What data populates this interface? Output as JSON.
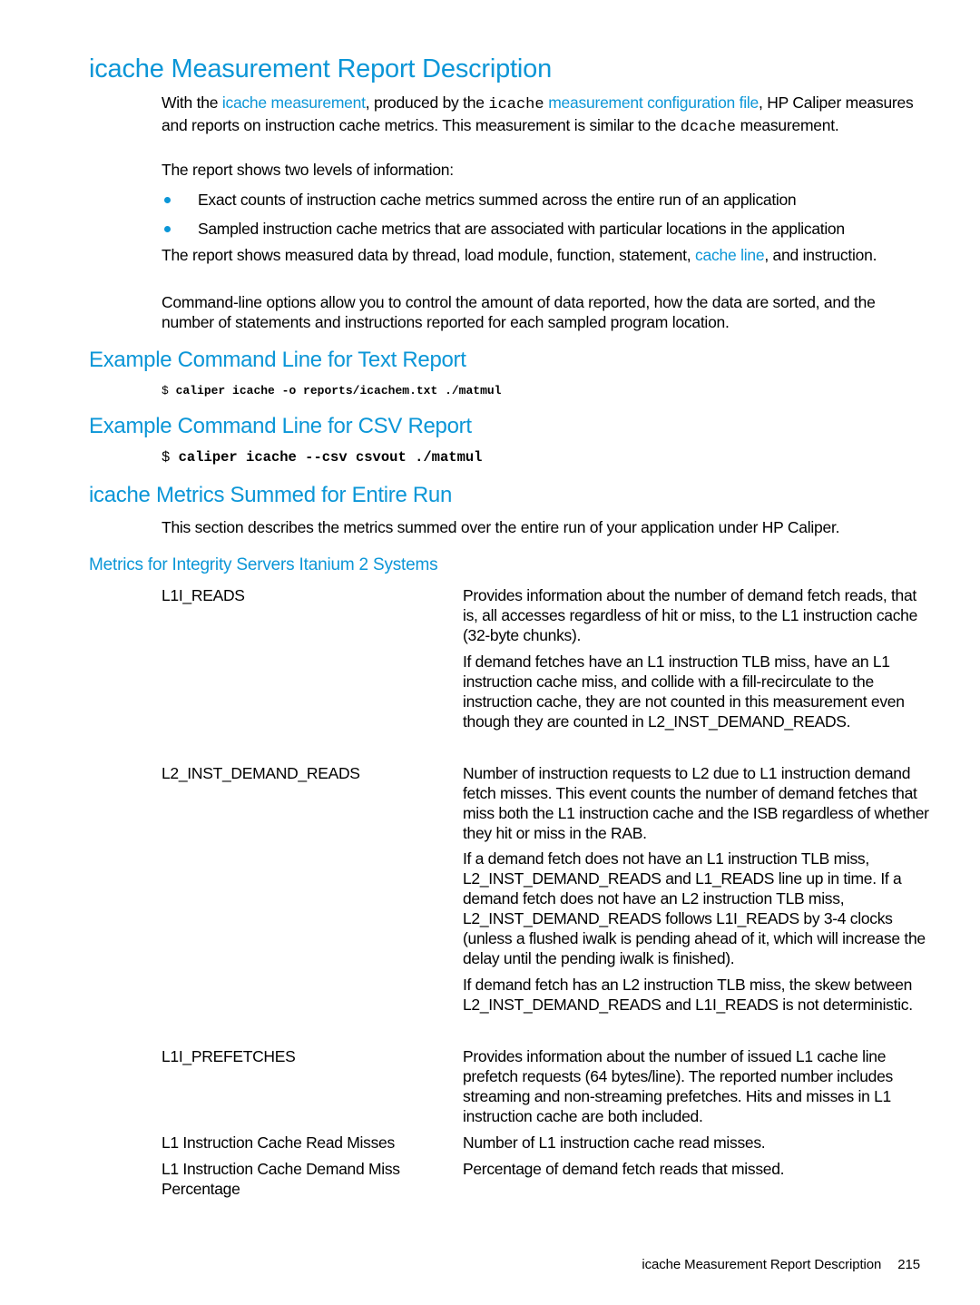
{
  "page": {
    "title": "icache Measurement Report Description",
    "intro": {
      "p1": {
        "t1": "With the ",
        "link1": "icache measurement",
        "t2": ", produced by the ",
        "code1": "icache",
        "t3": " ",
        "link2": "measurement configuration file",
        "t4": ", HP Caliper measures and reports on instruction cache metrics. This measurement is similar to the ",
        "code2": "dcache",
        "t5": " measurement."
      },
      "p2": "The report shows two levels of information:",
      "bullets": [
        "Exact counts of instruction cache metrics summed across the entire run of an application",
        "Sampled instruction cache metrics that are associated with particular locations in the application"
      ],
      "p3": {
        "t1": "The report shows measured data by thread, load module, function, statement, ",
        "link": "cache line",
        "t2": ", and instruction."
      },
      "p4": "Command-line options allow you to control the amount of data reported, how the data are sorted, and the number of statements and instructions reported for each sampled program location."
    },
    "text_report": {
      "heading": "Example Command Line for Text Report",
      "prompt": "$",
      "command": "caliper icache -o reports/icachem.txt ./matmul"
    },
    "csv_report": {
      "heading": "Example Command Line for CSV Report",
      "prompt": "$",
      "command": "caliper icache --csv csvout ./matmul"
    },
    "metrics_summed": {
      "heading": "icache Metrics Summed for Entire Run",
      "description": "This section describes the metrics summed over the entire run of your application under HP Caliper."
    },
    "integrity": {
      "heading": "Metrics for Integrity Servers Itanium 2 Systems",
      "metrics": [
        {
          "term": "L1I_READS",
          "paragraphs": [
            "Provides information about the number of demand fetch reads, that is, all accesses regardless of hit or miss, to the L1 instruction cache (32-byte chunks).",
            "If demand fetches have an L1 instruction TLB miss, have an L1 instruction cache miss, and collide with a fill-recirculate to the instruction cache, they are not counted in this measurement even though they are counted in L2_INST_DEMAND_READS."
          ]
        },
        {
          "term": "L2_INST_DEMAND_READS",
          "paragraphs": [
            "Number of instruction requests to L2 due to L1 instruction demand fetch misses. This event counts the number of demand fetches that miss both the L1 instruction cache and the ISB regardless of whether they hit or miss in the RAB.",
            "If a demand fetch does not have an L1 instruction TLB miss, L2_INST_DEMAND_READS and L1_READS line up in time. If a demand fetch does not have an L2 instruction TLB miss, L2_INST_DEMAND_READS follows L1I_READS by 3-4 clocks (unless a flushed iwalk is pending ahead of it, which will increase the delay until the pending iwalk is finished).",
            "If demand fetch has an L2 instruction TLB miss, the skew between L2_INST_DEMAND_READS and L1I_READS is not deterministic."
          ]
        },
        {
          "term": "L1I_PREFETCHES",
          "paragraphs": [
            "Provides information about the number of issued L1 cache line prefetch requests (64 bytes/line). The reported number includes streaming and non-streaming prefetches. Hits and misses in L1 instruction cache are both included."
          ]
        },
        {
          "term": "L1 Instruction Cache Read Misses",
          "paragraphs": [
            "Number of L1 instruction cache read misses."
          ]
        },
        {
          "term": "L1 Instruction Cache Demand Miss Percentage",
          "paragraphs": [
            "Percentage of demand fetch reads that missed."
          ]
        }
      ]
    },
    "footer": {
      "section": "icache Measurement Report Description",
      "page_number": "215"
    }
  }
}
